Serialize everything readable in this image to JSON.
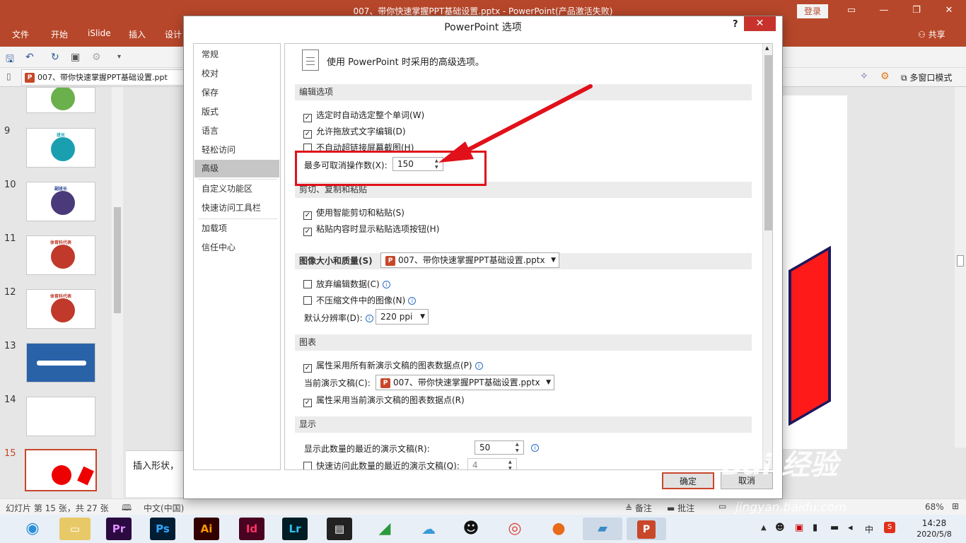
{
  "window": {
    "title": "007、带你快速掌握PPT基础设置.pptx  -  PowerPoint(产品激活失败)",
    "login": "登录",
    "share": "共享"
  },
  "ribbon_tabs": [
    "文件",
    "开始",
    "iSlide",
    "插入",
    "设计"
  ],
  "doc_tab": "007、带你快速掌握PPT基础设置.ppt",
  "multiwindow": "多窗口模式",
  "slides": [
    {
      "num": "9",
      "label": "班长",
      "label_color": "#1a9fb0"
    },
    {
      "num": "10",
      "label": "副班长",
      "label_color": "#2a4a9a"
    },
    {
      "num": "11",
      "label": "体育科代表",
      "label_color": "#c0392b"
    },
    {
      "num": "12",
      "label": "体育科代表",
      "label_color": "#c0392b"
    },
    {
      "num": "13",
      "label": ""
    },
    {
      "num": "14",
      "label": ""
    },
    {
      "num": "15",
      "label": ""
    }
  ],
  "notes_text": "插入形状，",
  "status": {
    "slide_info": "幻灯片 第 15 张，共 27 张",
    "language": "中文(中国)",
    "notes": "备注",
    "comments": "批注",
    "zoom": "68%"
  },
  "taskbar": {
    "apps": [
      "Pr",
      "Ps",
      "Ai",
      "Id",
      "Lr"
    ],
    "time": "14:28",
    "date": "2020/5/8",
    "ime": "中"
  },
  "dialog": {
    "title": "PowerPoint 选项",
    "help": "?",
    "close": "✕",
    "nav": [
      "常规",
      "校对",
      "保存",
      "版式",
      "语言",
      "轻松访问",
      "高级",
      "自定义功能区",
      "快速访问工具栏",
      "加载项",
      "信任中心"
    ],
    "selected_nav": "高级",
    "header": "使用 PowerPoint 时采用的高级选项。",
    "sections": {
      "editing": "编辑选项",
      "clipboard": "剪切、复制和粘贴",
      "image": "图像大小和质量(S)",
      "chart": "图表",
      "display": "显示"
    },
    "options": {
      "select_word": "选定时自动选定整个单词(W)",
      "drag_drop": "允许拖放式文字编辑(D)",
      "no_hyperlink": "不自动超链接屏幕截图(H)",
      "max_undo_label": "最多可取消操作数(X):",
      "max_undo_value": "150",
      "smart_cut": "使用智能剪切和粘贴(S)",
      "paste_options": "粘贴内容时显示粘贴选项按钮(H)",
      "image_file": "007、带你快速掌握PPT基础设置.pptx",
      "discard_edit": "放弃编辑数据(C)",
      "no_compress": "不压缩文件中的图像(N)",
      "default_res_label": "默认分辨率(D):",
      "default_res_value": "220 ppi",
      "chart_all": "属性采用所有新演示文稿的图表数据点(P)",
      "current_pres_label": "当前演示文稿(C):",
      "current_pres_value": "007、带你快速掌握PPT基础设置.pptx",
      "chart_current": "属性采用当前演示文稿的图表数据点(R)",
      "recent_count_label": "显示此数量的最近的演示文稿(R):",
      "recent_count_value": "50",
      "quick_access_label": "快速访问此数量的最近的演示文稿(Q):",
      "quick_access_value": "4"
    },
    "ok": "确定",
    "cancel": "取消"
  },
  "watermark": {
    "brand": "Bai 经验",
    "url": "jingyan.baidu.com"
  },
  "colors": {
    "ppt_red": "#b7472a",
    "annotation_red": "#e0111a"
  }
}
